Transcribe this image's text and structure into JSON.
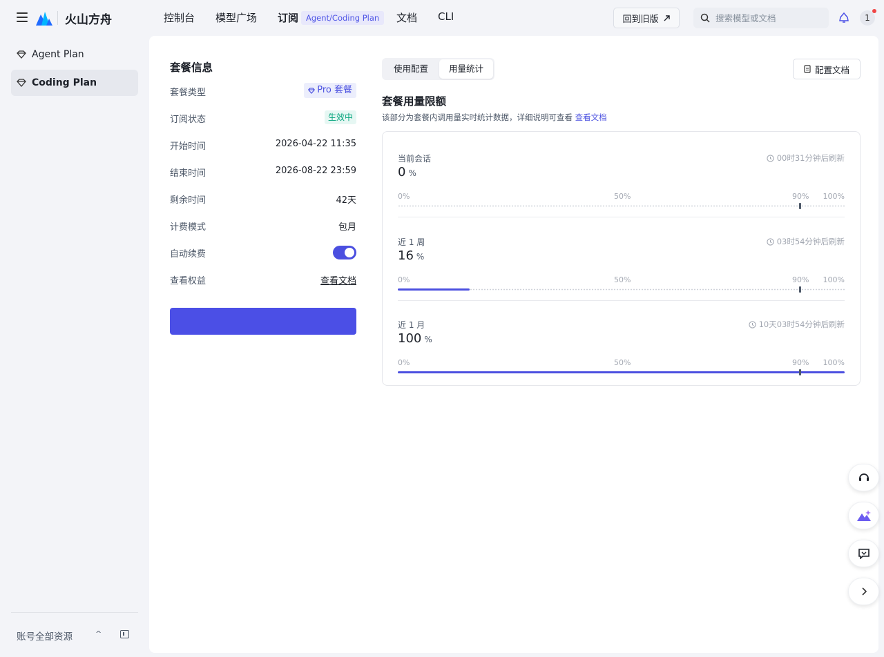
{
  "header": {
    "brand": "火山方舟",
    "nav": [
      "控制台",
      "模型广场",
      "订阅",
      "文档",
      "CLI"
    ],
    "nav_badge": "Agent/Coding Plan",
    "old_version": "回到旧版",
    "search_placeholder": "搜索模型或文档",
    "avatar": "1"
  },
  "sidebar": {
    "items": [
      {
        "label": "Agent Plan"
      },
      {
        "label": "Coding Plan"
      }
    ],
    "footer_label": "账号全部资源",
    "caret": "^"
  },
  "plan": {
    "title": "套餐信息",
    "rows": [
      {
        "label": "套餐类型",
        "value": "Pro 套餐"
      },
      {
        "label": "订阅状态",
        "value": "生效中"
      },
      {
        "label": "开始时间",
        "value": "2026-04-22 11:35"
      },
      {
        "label": "结束时间",
        "value": "2026-08-22 23:59"
      },
      {
        "label": "剩余时间",
        "value": "42天"
      },
      {
        "label": "计费模式",
        "value": "包月"
      },
      {
        "label": "自动续费",
        "value": true
      },
      {
        "label": "查看权益",
        "value": "查看文档"
      }
    ]
  },
  "tabs": [
    "使用配置",
    "用量统计"
  ],
  "active_tab": "用量统计",
  "config_doc": "配置文档",
  "usage": {
    "title": "套餐用量限额",
    "desc": "该部分为套餐内调用量实时统计数据，详细说明可查看 ",
    "desc_link": "查看文档",
    "ticks": [
      "0%",
      "50%",
      "90%",
      "100%"
    ],
    "unit": "%",
    "blocks": [
      {
        "label": "当前会话",
        "value": "0",
        "refresh": "00时31分钟后刷新",
        "percent": 0
      },
      {
        "label": "近 1 周",
        "value": "16",
        "refresh": "03时54分钟后刷新",
        "percent": 16
      },
      {
        "label": "近 1 月",
        "value": "100",
        "refresh": "10天03时54分钟后刷新",
        "percent": 100
      }
    ]
  },
  "colors": {
    "accent": "#4b4fe6",
    "status_green": "#00a37a",
    "link": "#4a50e0"
  }
}
